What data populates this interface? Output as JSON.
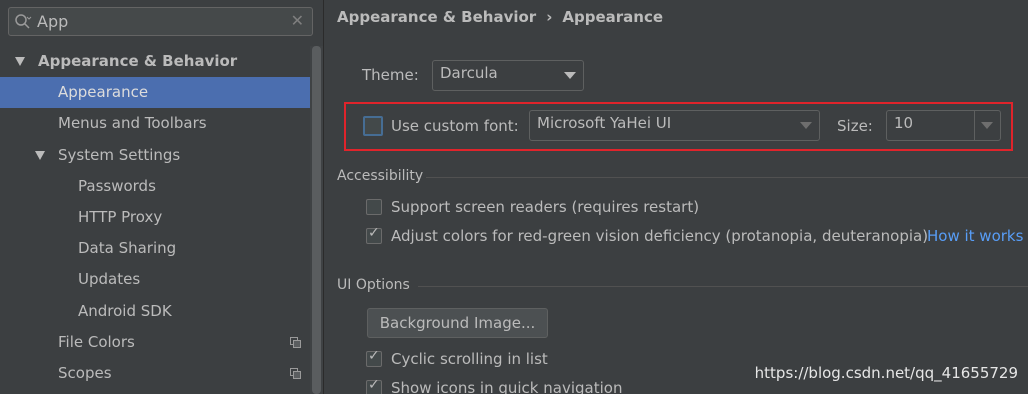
{
  "search": {
    "value": "App",
    "clear_glyph": "✕"
  },
  "tree": {
    "items": [
      {
        "label": "Appearance & Behavior",
        "level": 0,
        "expanded": true,
        "bold": true,
        "selected": false,
        "project_icon": false
      },
      {
        "label": "Appearance",
        "level": 1,
        "selected": true,
        "project_icon": false
      },
      {
        "label": "Menus and Toolbars",
        "level": 1,
        "selected": false,
        "project_icon": false
      },
      {
        "label": "System Settings",
        "level": 1,
        "expanded": true,
        "selected": false,
        "project_icon": false
      },
      {
        "label": "Passwords",
        "level": 2,
        "selected": false,
        "project_icon": false
      },
      {
        "label": "HTTP Proxy",
        "level": 2,
        "selected": false,
        "project_icon": false
      },
      {
        "label": "Data Sharing",
        "level": 2,
        "selected": false,
        "project_icon": false
      },
      {
        "label": "Updates",
        "level": 2,
        "selected": false,
        "project_icon": false
      },
      {
        "label": "Android SDK",
        "level": 2,
        "selected": false,
        "project_icon": false
      },
      {
        "label": "File Colors",
        "level": 1,
        "selected": false,
        "project_icon": true
      },
      {
        "label": "Scopes",
        "level": 1,
        "selected": false,
        "project_icon": true
      }
    ]
  },
  "breadcrumb": {
    "parent": "Appearance & Behavior",
    "separator": "›",
    "current": "Appearance"
  },
  "theme": {
    "label": "Theme:",
    "value": "Darcula"
  },
  "custom_font": {
    "checkbox_label": "Use custom font:",
    "checked": false,
    "font_value": "Microsoft YaHei UI",
    "size_label": "Size:",
    "size_value": "10"
  },
  "accessibility": {
    "title": "Accessibility",
    "screen_readers_label": "Support screen readers (requires restart)",
    "screen_readers_checked": false,
    "adjust_colors_label": "Adjust colors for red-green vision deficiency (protanopia, deuteranopia)",
    "adjust_colors_checked": true,
    "how_it_works_link": "How it works"
  },
  "ui_options": {
    "title": "UI Options",
    "background_image_button": "Background Image...",
    "cyclic_scrolling_label": "Cyclic scrolling in list",
    "cyclic_scrolling_checked": true,
    "show_icons_label": "Show icons in quick navigation",
    "show_icons_checked": true
  },
  "watermark": "https://blog.csdn.net/qq_41655729",
  "colors": {
    "background": "#3c3f41",
    "selection": "#4b6eaf",
    "text": "#bbbbbb",
    "link": "#589df6",
    "highlight_box": "#e0242b"
  }
}
